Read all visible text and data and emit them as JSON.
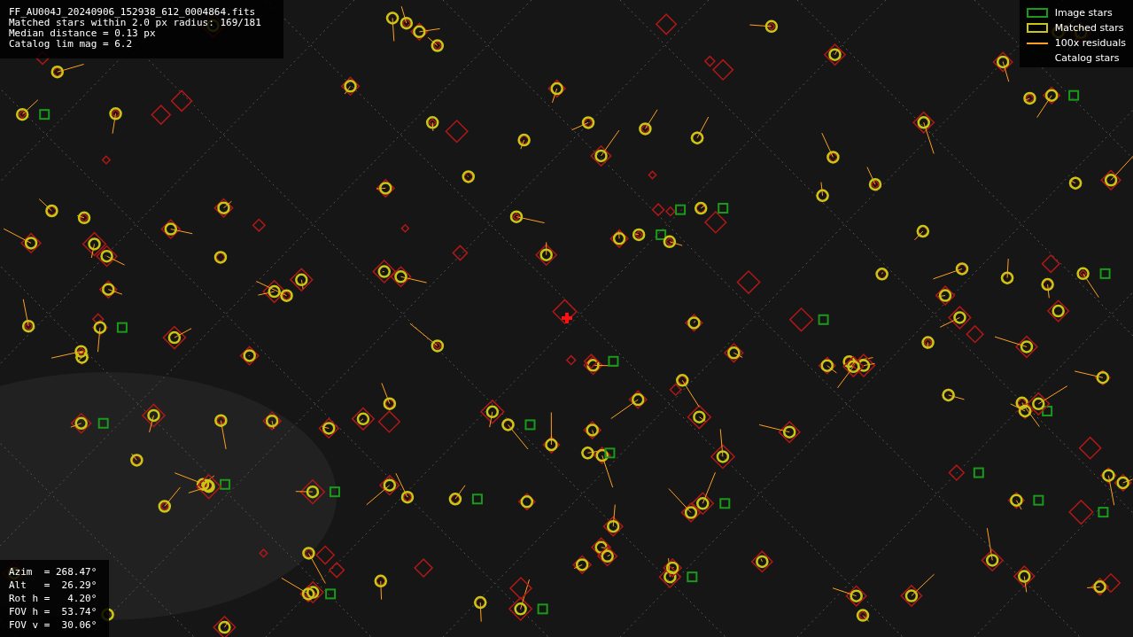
{
  "info_lines": [
    "FF_AU004J_20240906_152938_612_0004864.fits",
    "Matched stars within 2.0 px radius: 169/181",
    "Median distance = 0.13 px",
    "Catalog lim mag = 6.2"
  ],
  "legend": [
    {
      "label": "Image stars",
      "kind": "box",
      "color": "#1a9a1a"
    },
    {
      "label": "Matched stars",
      "kind": "box",
      "color": "#c8c814"
    },
    {
      "label": "100x residuals",
      "kind": "line",
      "color": "#ffa020"
    },
    {
      "label": "Catalog stars",
      "kind": "none"
    }
  ],
  "pointing": [
    "Azim  = 268.47°",
    "Alt   =  26.29°",
    "Rot h =   4.20°",
    "FOV h =  53.74°",
    "FOV v =  30.06°"
  ]
}
